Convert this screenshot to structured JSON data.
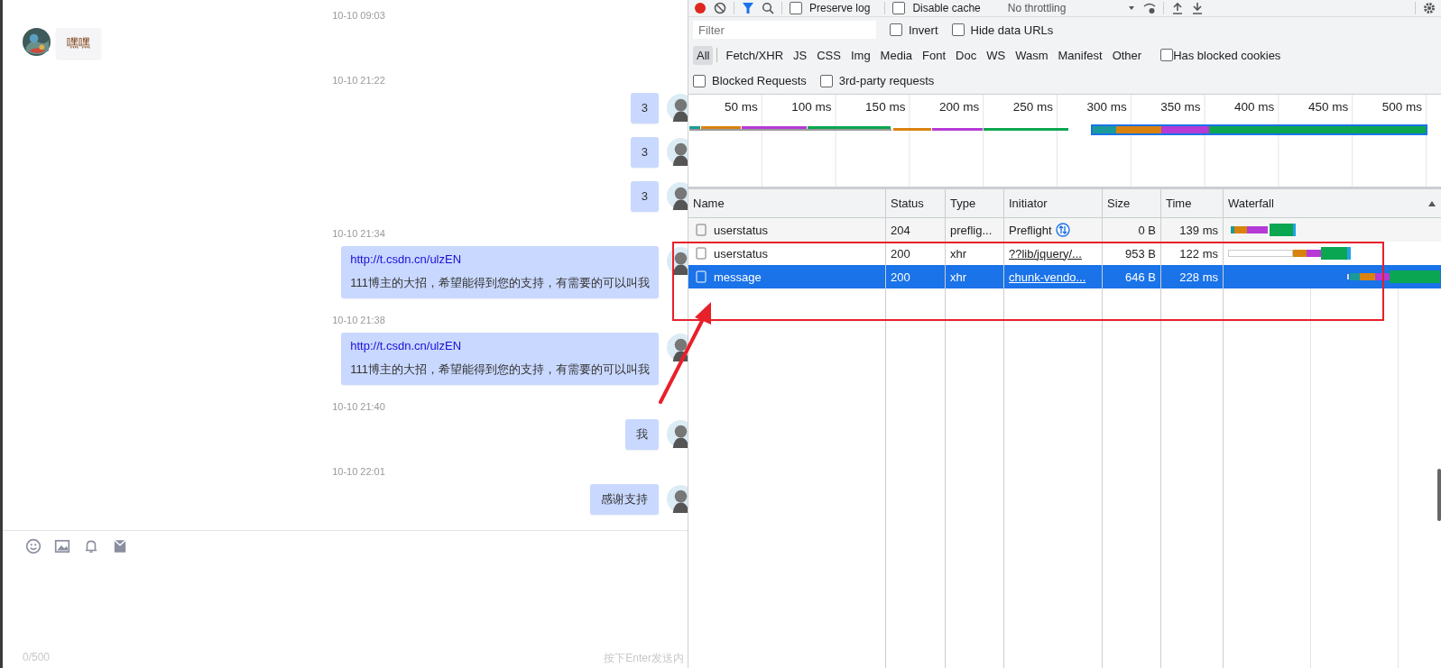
{
  "chat": {
    "messages": [
      {
        "kind": "time",
        "text": "10-10 09:03"
      },
      {
        "kind": "received",
        "text": "嘿嘿"
      },
      {
        "kind": "time",
        "text": "10-10 21:22"
      },
      {
        "kind": "sent",
        "text": "3"
      },
      {
        "kind": "sent",
        "text": "3"
      },
      {
        "kind": "sent",
        "text": "3"
      },
      {
        "kind": "time",
        "text": "10-10 21:34"
      },
      {
        "kind": "sent",
        "link": "http://t.csdn.cn/ulzEN",
        "text": "111博主的大招，希望能得到您的支持，有需要的可以叫我"
      },
      {
        "kind": "time",
        "text": "10-10 21:38"
      },
      {
        "kind": "sent",
        "link": "http://t.csdn.cn/ulzEN",
        "text": "111博主的大招，希望能得到您的支持，有需要的可以叫我"
      },
      {
        "kind": "time",
        "text": "10-10 21:40"
      },
      {
        "kind": "sent",
        "text": "我"
      },
      {
        "kind": "time",
        "text": "10-10 22:01"
      },
      {
        "kind": "sent",
        "text": "感谢支持"
      }
    ],
    "input": {
      "counter": "0/500",
      "hint": "按下Enter发送内"
    }
  },
  "devtools": {
    "toolbar": {
      "preserve_log": {
        "label": "Preserve log",
        "checked": false
      },
      "disable_cache": {
        "label": "Disable cache",
        "checked": false
      },
      "throttling": "No throttling"
    },
    "filter": {
      "placeholder": "Filter"
    },
    "invert": {
      "label": "Invert",
      "checked": false
    },
    "hide_data_urls": {
      "label": "Hide data URLs",
      "checked": false
    },
    "types": [
      {
        "label": "All",
        "selected": true
      },
      {
        "label": "Fetch/XHR",
        "selected": false
      },
      {
        "label": "JS",
        "selected": false
      },
      {
        "label": "CSS",
        "selected": false
      },
      {
        "label": "Img",
        "selected": false
      },
      {
        "label": "Media",
        "selected": false
      },
      {
        "label": "Font",
        "selected": false
      },
      {
        "label": "Doc",
        "selected": false
      },
      {
        "label": "WS",
        "selected": false
      },
      {
        "label": "Wasm",
        "selected": false
      },
      {
        "label": "Manifest",
        "selected": false
      },
      {
        "label": "Other",
        "selected": false
      }
    ],
    "has_blocked_cookies": {
      "label": "Has blocked cookies",
      "checked": false
    },
    "blocked_requests": {
      "label": "Blocked Requests",
      "checked": false
    },
    "third_party": {
      "label": "3rd-party requests",
      "checked": false
    },
    "overview": {
      "ticks": [
        "50 ms",
        "100 ms",
        "150 ms",
        "200 ms",
        "250 ms",
        "300 ms",
        "350 ms",
        "400 ms",
        "450 ms",
        "500 ms"
      ]
    },
    "table": {
      "columns": [
        "Name",
        "Status",
        "Type",
        "Initiator",
        "Size",
        "Time",
        "Waterfall"
      ],
      "rows": [
        {
          "name": "userstatus",
          "status": "204",
          "type": "preflig...",
          "initiator": "Preflight",
          "kind": "preflight",
          "size": "0 B",
          "time": "139 ms",
          "selected": false
        },
        {
          "name": "userstatus",
          "status": "200",
          "type": "xhr",
          "initiator": "??lib/jquery/...",
          "kind": "link",
          "size": "953 B",
          "time": "122 ms",
          "selected": false
        },
        {
          "name": "message",
          "status": "200",
          "type": "xhr",
          "initiator": "chunk-vendo...",
          "kind": "link",
          "size": "646 B",
          "time": "228 ms",
          "selected": true
        }
      ]
    }
  }
}
